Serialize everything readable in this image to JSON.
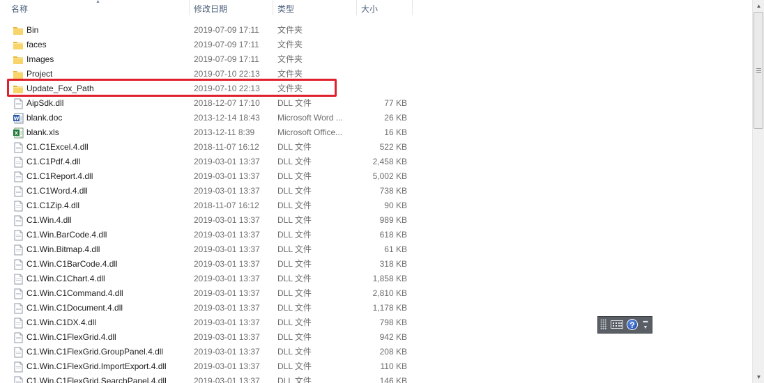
{
  "header": {
    "col_name": "名称",
    "col_date": "修改日期",
    "col_type": "类型",
    "col_size": "大小"
  },
  "files": [
    {
      "name": "Bin",
      "date": "2019-07-09 17:11",
      "type": "文件夹",
      "size": "",
      "icon": "folder-icon"
    },
    {
      "name": "faces",
      "date": "2019-07-09 17:11",
      "type": "文件夹",
      "size": "",
      "icon": "folder-icon"
    },
    {
      "name": "Images",
      "date": "2019-07-09 17:11",
      "type": "文件夹",
      "size": "",
      "icon": "folder-icon"
    },
    {
      "name": "Project",
      "date": "2019-07-10 22:13",
      "type": "文件夹",
      "size": "",
      "icon": "folder-icon"
    },
    {
      "name": "Update_Fox_Path",
      "date": "2019-07-10 22:13",
      "type": "文件夹",
      "size": "",
      "icon": "folder-icon"
    },
    {
      "name": "AipSdk.dll",
      "date": "2018-12-07 17:10",
      "type": "DLL 文件",
      "size": "77 KB",
      "icon": "dll-file-icon"
    },
    {
      "name": "blank.doc",
      "date": "2013-12-14 18:43",
      "type": "Microsoft Word ...",
      "size": "26 KB",
      "icon": "word-doc-icon"
    },
    {
      "name": "blank.xls",
      "date": "2013-12-11 8:39",
      "type": "Microsoft Office...",
      "size": "16 KB",
      "icon": "excel-xls-icon"
    },
    {
      "name": "C1.C1Excel.4.dll",
      "date": "2018-11-07 16:12",
      "type": "DLL 文件",
      "size": "522 KB",
      "icon": "dll-file-icon"
    },
    {
      "name": "C1.C1Pdf.4.dll",
      "date": "2019-03-01 13:37",
      "type": "DLL 文件",
      "size": "2,458 KB",
      "icon": "dll-file-icon"
    },
    {
      "name": "C1.C1Report.4.dll",
      "date": "2019-03-01 13:37",
      "type": "DLL 文件",
      "size": "5,002 KB",
      "icon": "dll-file-icon"
    },
    {
      "name": "C1.C1Word.4.dll",
      "date": "2019-03-01 13:37",
      "type": "DLL 文件",
      "size": "738 KB",
      "icon": "dll-file-icon"
    },
    {
      "name": "C1.C1Zip.4.dll",
      "date": "2018-11-07 16:12",
      "type": "DLL 文件",
      "size": "90 KB",
      "icon": "dll-file-icon"
    },
    {
      "name": "C1.Win.4.dll",
      "date": "2019-03-01 13:37",
      "type": "DLL 文件",
      "size": "989 KB",
      "icon": "dll-file-icon"
    },
    {
      "name": "C1.Win.BarCode.4.dll",
      "date": "2019-03-01 13:37",
      "type": "DLL 文件",
      "size": "618 KB",
      "icon": "dll-file-icon"
    },
    {
      "name": "C1.Win.Bitmap.4.dll",
      "date": "2019-03-01 13:37",
      "type": "DLL 文件",
      "size": "61 KB",
      "icon": "dll-file-icon"
    },
    {
      "name": "C1.Win.C1BarCode.4.dll",
      "date": "2019-03-01 13:37",
      "type": "DLL 文件",
      "size": "318 KB",
      "icon": "dll-file-icon"
    },
    {
      "name": "C1.Win.C1Chart.4.dll",
      "date": "2019-03-01 13:37",
      "type": "DLL 文件",
      "size": "1,858 KB",
      "icon": "dll-file-icon"
    },
    {
      "name": "C1.Win.C1Command.4.dll",
      "date": "2019-03-01 13:37",
      "type": "DLL 文件",
      "size": "2,810 KB",
      "icon": "dll-file-icon"
    },
    {
      "name": "C1.Win.C1Document.4.dll",
      "date": "2019-03-01 13:37",
      "type": "DLL 文件",
      "size": "1,178 KB",
      "icon": "dll-file-icon"
    },
    {
      "name": "C1.Win.C1DX.4.dll",
      "date": "2019-03-01 13:37",
      "type": "DLL 文件",
      "size": "798 KB",
      "icon": "dll-file-icon"
    },
    {
      "name": "C1.Win.C1FlexGrid.4.dll",
      "date": "2019-03-01 13:37",
      "type": "DLL 文件",
      "size": "942 KB",
      "icon": "dll-file-icon"
    },
    {
      "name": "C1.Win.C1FlexGrid.GroupPanel.4.dll",
      "date": "2019-03-01 13:37",
      "type": "DLL 文件",
      "size": "208 KB",
      "icon": "dll-file-icon"
    },
    {
      "name": "C1.Win.C1FlexGrid.ImportExport.4.dll",
      "date": "2019-03-01 13:37",
      "type": "DLL 文件",
      "size": "110 KB",
      "icon": "dll-file-icon"
    },
    {
      "name": "C1.Win.C1FlexGrid.SearchPanel.4.dll",
      "date": "2019-03-01 13:37",
      "type": "DLL 文件",
      "size": "146 KB",
      "icon": "dll-file-icon"
    }
  ],
  "highlight": {
    "row_name": "Update_Fox_Path",
    "color": "#e0212d"
  },
  "language_bar": {
    "help_glyph": "?"
  }
}
